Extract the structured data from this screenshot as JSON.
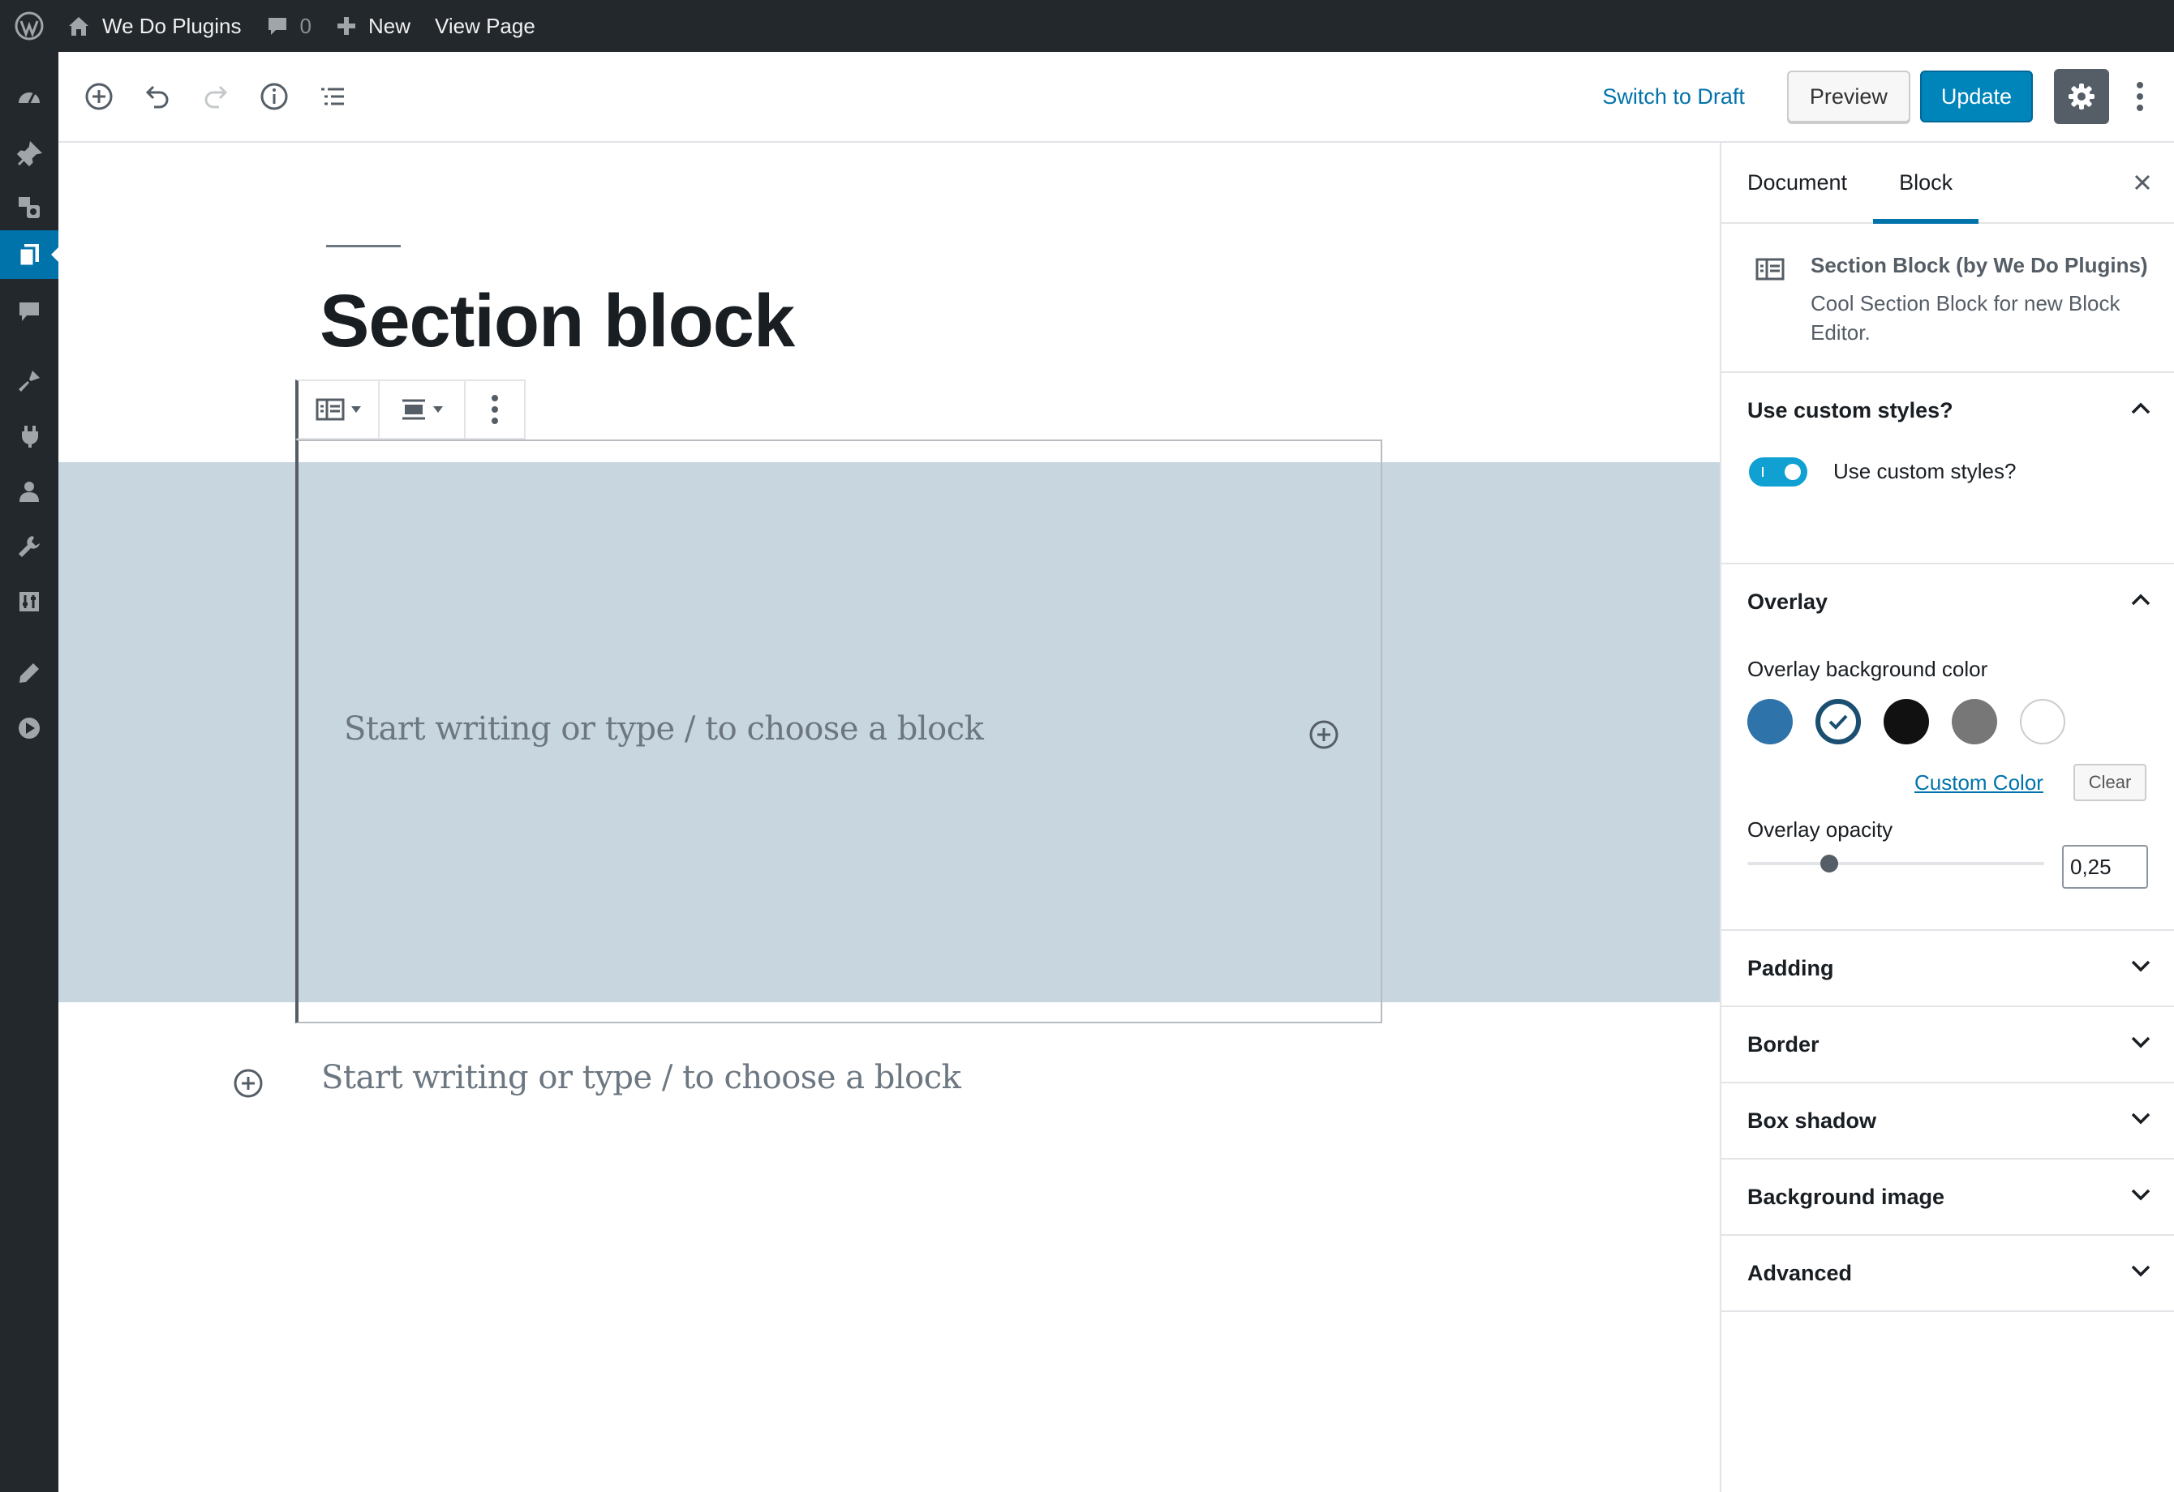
{
  "adminbar": {
    "site_name": "We Do Plugins",
    "comments_count": "0",
    "new_label": "New",
    "view_page_label": "View Page"
  },
  "header": {
    "switch_draft": "Switch to Draft",
    "preview": "Preview",
    "update": "Update"
  },
  "editor": {
    "post_title": "Section block",
    "inner_placeholder": "Start writing or type / to choose a block",
    "outer_placeholder": "Start writing or type / to choose a block"
  },
  "sidebar": {
    "tabs": {
      "document": "Document",
      "block": "Block"
    },
    "block_card": {
      "title": "Section Block (by We Do Plugins)",
      "description": "Cool Section Block for new Block Editor."
    },
    "custom_styles": {
      "title": "Use custom styles?",
      "toggle_label": "Use custom styles?"
    },
    "overlay": {
      "title": "Overlay",
      "bg_color_label": "Overlay background color",
      "custom_color": "Custom Color",
      "clear": "Clear",
      "opacity_label": "Overlay opacity",
      "opacity_value": "0,25",
      "opacity_fraction": 0.25,
      "swatches": [
        "#2e73aa",
        "#ffffff",
        "#111111",
        "#777777",
        "#ffffff"
      ]
    },
    "panels": {
      "padding": "Padding",
      "border": "Border",
      "box_shadow": "Box shadow",
      "background_image": "Background image",
      "advanced": "Advanced"
    }
  },
  "colors": {
    "accent": "#0073aa",
    "update_button": "#0085ba",
    "section_background": "#c8d6df",
    "admin_dark": "#23282d"
  }
}
